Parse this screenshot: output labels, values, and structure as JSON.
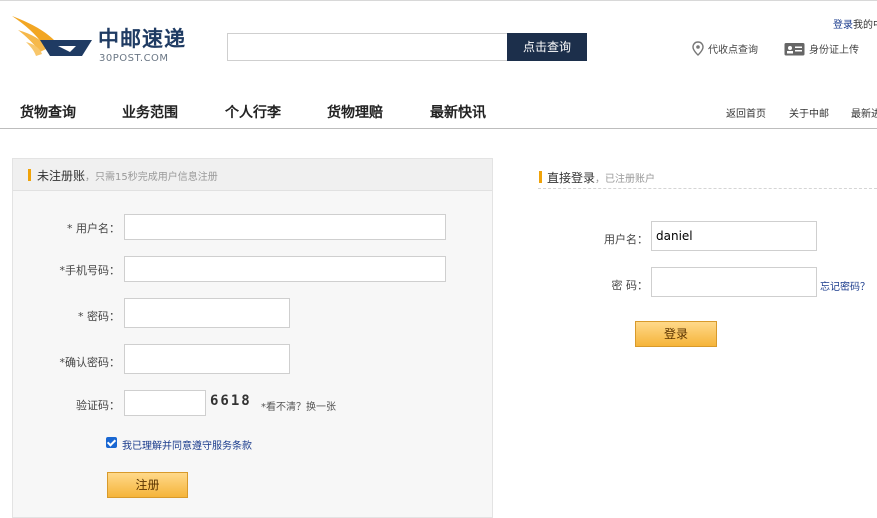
{
  "header": {
    "top_links": {
      "login": "登录",
      "mine": "我的中"
    },
    "logo": {
      "name": "中邮速递",
      "domain": "30POST.COM"
    },
    "search": {
      "placeholder": "",
      "value": "",
      "button": "点击查询"
    },
    "utility": [
      {
        "icon": "location-pin-icon",
        "label": "代收点查询"
      },
      {
        "icon": "id-card-icon",
        "label": "身份证上传"
      }
    ]
  },
  "nav": {
    "main": [
      "货物查询",
      "业务范围",
      "个人行李",
      "货物理赔",
      "最新快讯"
    ],
    "right": [
      "返回首页",
      "关于中邮",
      "最新进"
    ]
  },
  "register": {
    "title": "未注册账",
    "hint": "，只需15秒完成用户信息注册",
    "fields": {
      "username": {
        "label": "* 用户名：",
        "value": ""
      },
      "phone": {
        "label": "*手机号码：",
        "value": ""
      },
      "password": {
        "label": "* 密码：",
        "value": ""
      },
      "confirm": {
        "label": "*确认密码：",
        "value": ""
      },
      "captcha": {
        "label": "验证码：",
        "value": "",
        "code": "6618",
        "hint": "*看不清？换一张"
      }
    },
    "agree": "我已理解并同意遵守服务条款",
    "button": "注册"
  },
  "login": {
    "title": "直接登录",
    "hint": "，已注册账户",
    "username": {
      "label": "用户名：",
      "value": "daniel"
    },
    "password": {
      "label": "密 码：",
      "value": ""
    },
    "forgot": "忘记密码？",
    "button": "登录"
  },
  "colors": {
    "brand_navy": "#1c2f4b",
    "accent_orange": "#f0a30a",
    "link_blue": "#1a3b8c"
  }
}
